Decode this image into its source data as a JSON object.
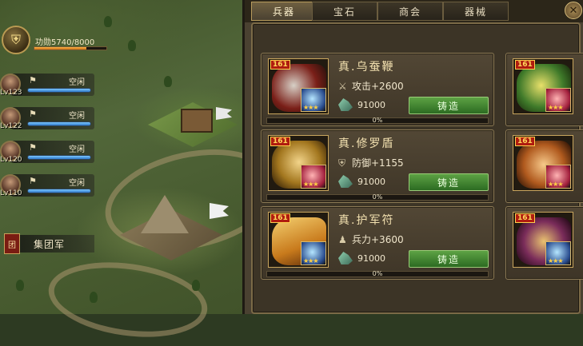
{
  "hud": {
    "merit_label": "功勋5740/8000",
    "merit_progress": 0.7175,
    "units": [
      {
        "level": "Lv123",
        "status": "空闲",
        "hp": 1.0
      },
      {
        "level": "Lv122",
        "status": "空闲",
        "hp": 1.0
      },
      {
        "level": "Lv120",
        "status": "空闲",
        "hp": 1.0
      },
      {
        "level": "Lv110",
        "status": "空闲",
        "hp": 1.0
      }
    ],
    "army_badge": "团",
    "army_label": "集团军"
  },
  "tabs": [
    {
      "label": "兵器",
      "active": true
    },
    {
      "label": "宝石",
      "active": false
    },
    {
      "label": "商会",
      "active": false
    },
    {
      "label": "器械",
      "active": false
    }
  ],
  "items": [
    {
      "level": "161",
      "name": "真.乌蚕鞭",
      "stat_icon": "sword-icon",
      "stat": "攻击+2600",
      "ore": "91000",
      "forge_label": "铸造",
      "progress": "0%",
      "gem": "blue-gem",
      "stars": "★★★"
    },
    {
      "level": "161",
      "name": "真.修罗盾",
      "stat_icon": "shield-icon",
      "stat": "防御+1155",
      "ore": "91000",
      "forge_label": "铸造",
      "progress": "0%",
      "gem": "red-gem",
      "stars": "★★★"
    },
    {
      "level": "161",
      "name": "真.护军符",
      "stat_icon": "soldier-icon",
      "stat": "兵力+3600",
      "ore": "91000",
      "forge_label": "铸造",
      "progress": "0%",
      "gem": "blue-gem",
      "stars": "★★★"
    }
  ],
  "partial_items": [
    {
      "level": "161",
      "stars": "★★★"
    },
    {
      "level": "161",
      "stars": "★★★"
    },
    {
      "level": "161",
      "stars": "★★★"
    }
  ],
  "colors": {
    "accent": "#b79a5c",
    "forge_button": "#4a8f36",
    "panel": "#4a4131"
  }
}
